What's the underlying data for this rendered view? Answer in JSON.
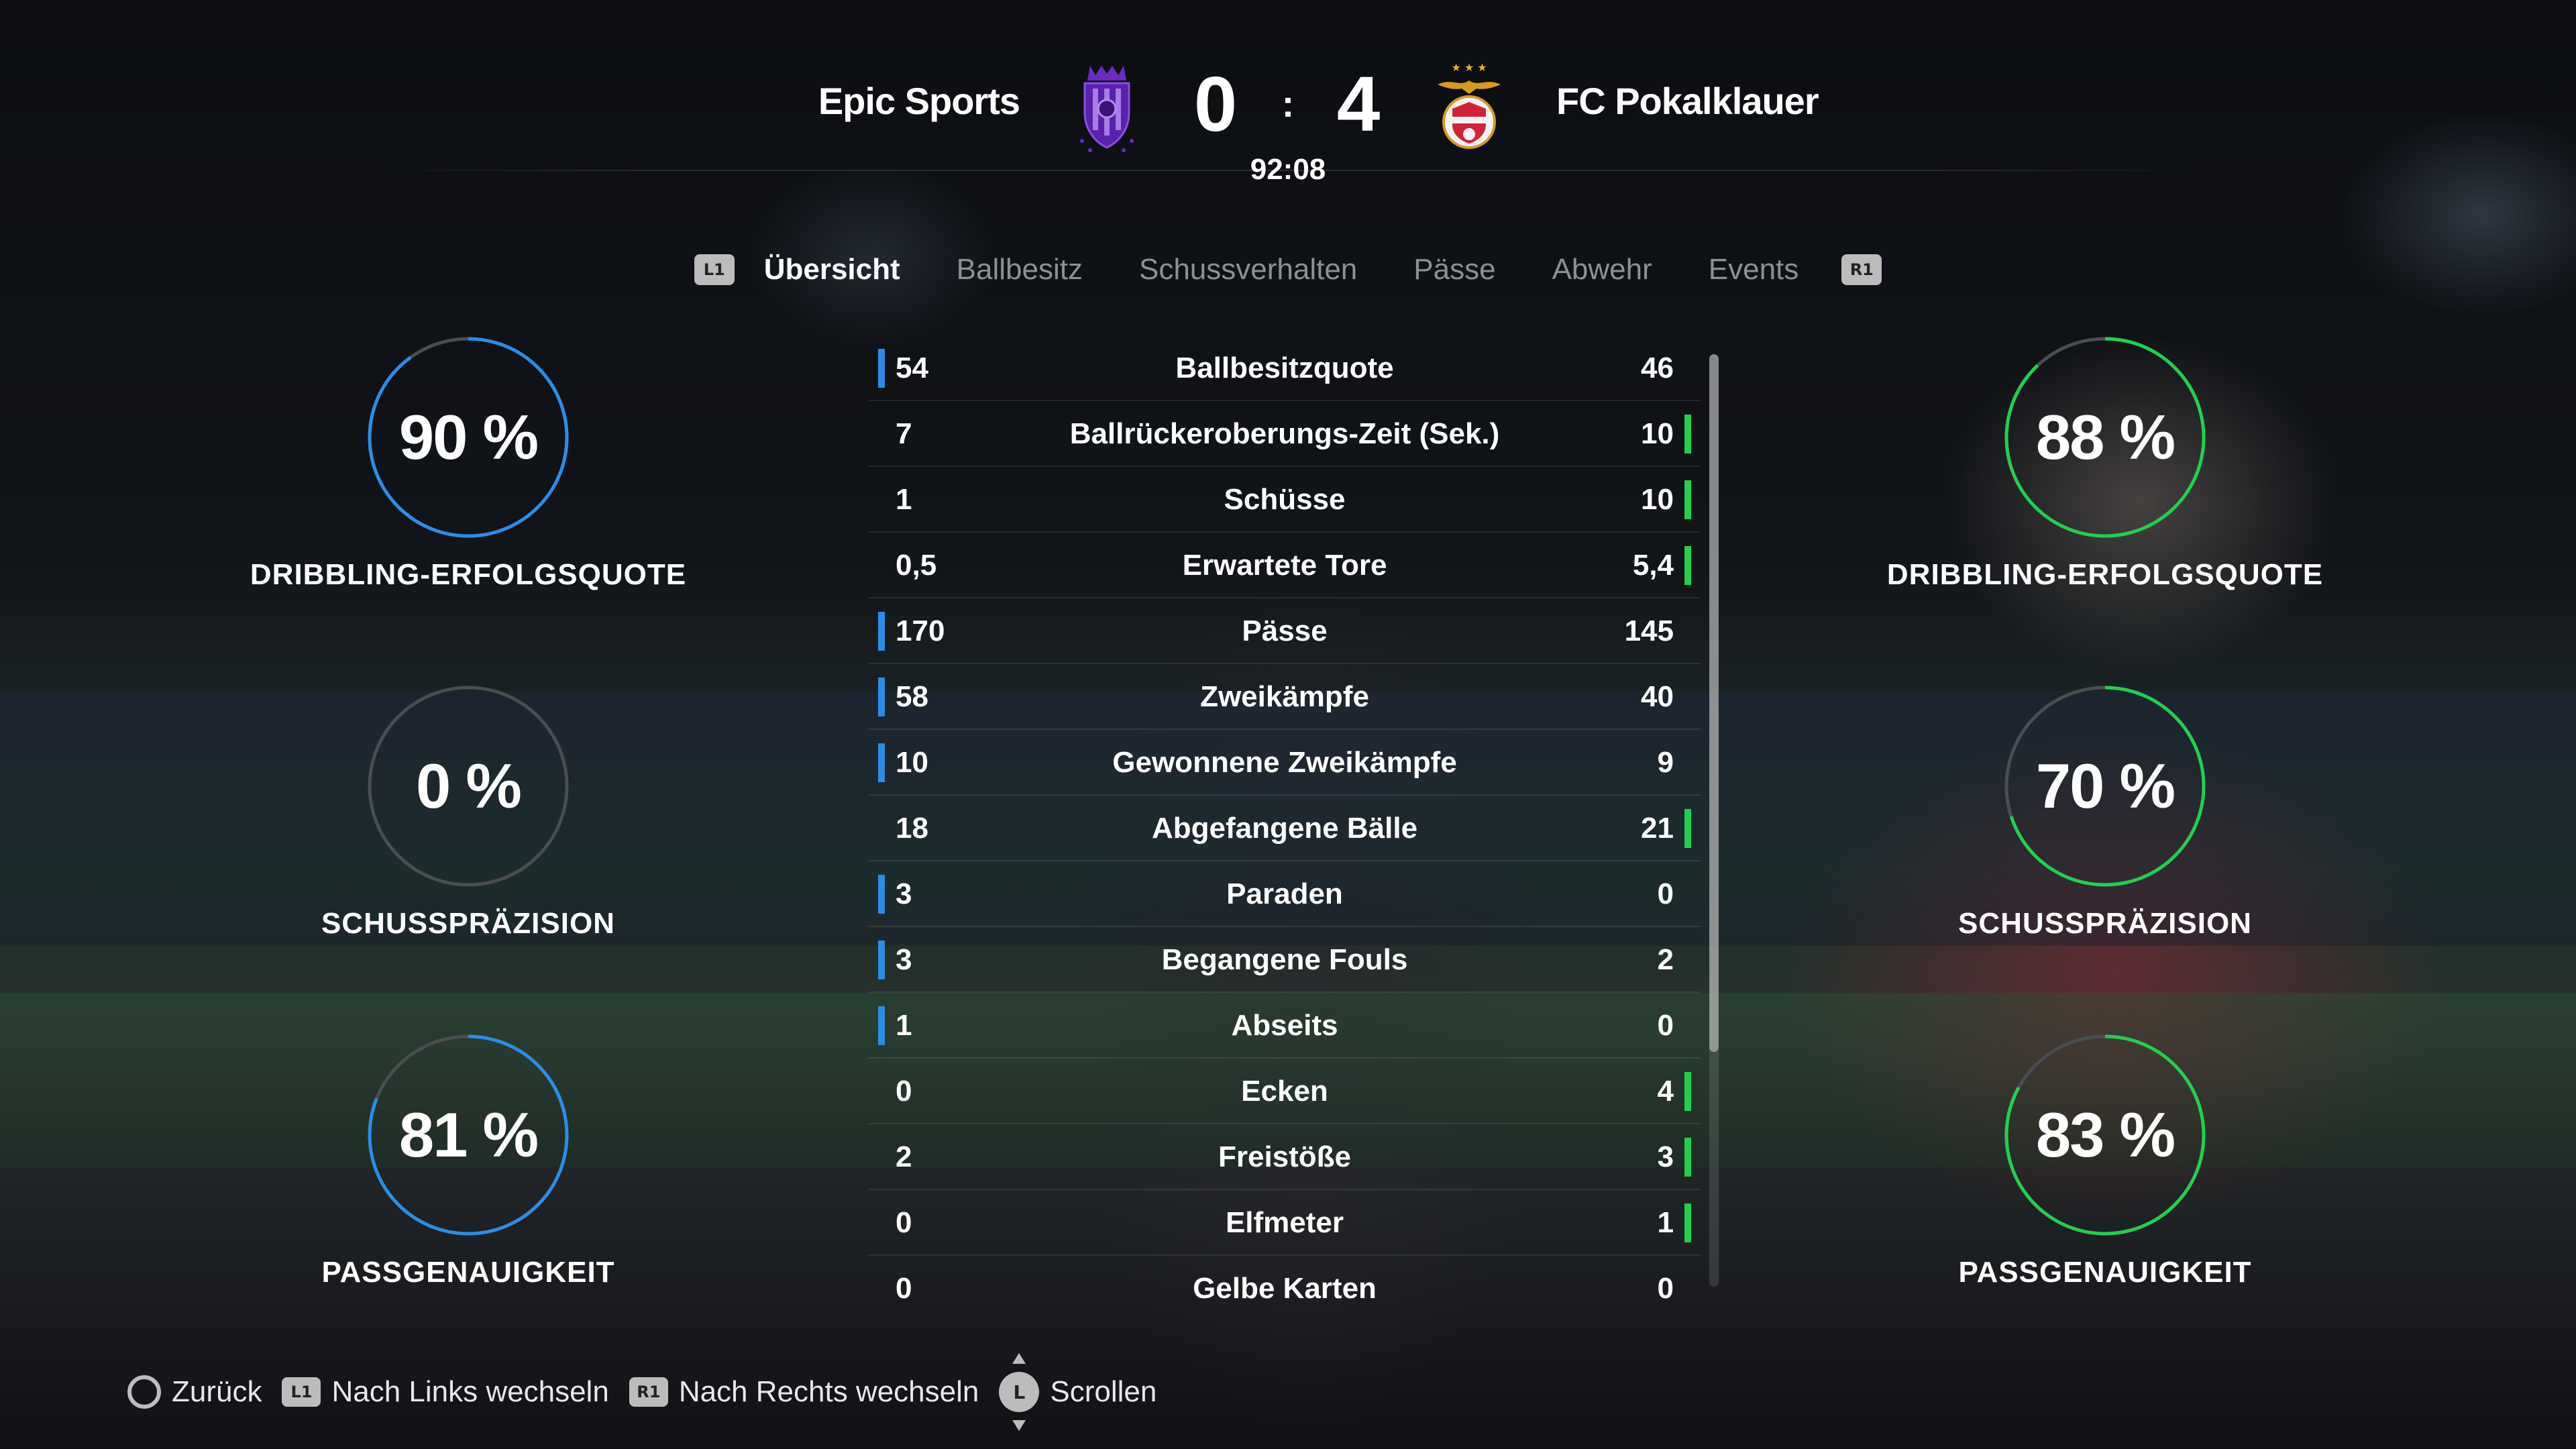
{
  "header": {
    "home_team": "Epic Sports",
    "away_team": "FC Pokalklauer",
    "home_score": "0",
    "away_score": "4",
    "score_separator": ":",
    "match_clock": "92:08"
  },
  "tabs": {
    "prev_button": "L1",
    "next_button": "R1",
    "items": [
      "Übersicht",
      "Ballbesitz",
      "Schussverhalten",
      "Pässe",
      "Abwehr",
      "Events"
    ],
    "active_index": 0
  },
  "colors": {
    "home_accent": "#2a8ee8",
    "away_accent": "#21d04e",
    "gauge_track": "#4a4d52"
  },
  "gauges": {
    "home": [
      {
        "value": "90 %",
        "fraction": 0.9,
        "label": "DRIBBLING-ERFOLGSQUOTE"
      },
      {
        "value": "0 %",
        "fraction": 0.0,
        "label": "SCHUSSPRÄZISION"
      },
      {
        "value": "81 %",
        "fraction": 0.81,
        "label": "PASSGENAUIGKEIT"
      }
    ],
    "away": [
      {
        "value": "88 %",
        "fraction": 0.88,
        "label": "DRIBBLING-ERFOLGSQUOTE"
      },
      {
        "value": "70 %",
        "fraction": 0.7,
        "label": "SCHUSSPRÄZISION"
      },
      {
        "value": "83 %",
        "fraction": 0.83,
        "label": "PASSGENAUIGKEIT"
      }
    ]
  },
  "stats": [
    {
      "name": "Ballbesitzquote",
      "home": "54",
      "away": "46",
      "leader": "home"
    },
    {
      "name": "Ballrückeroberungs-Zeit (Sek.)",
      "home": "7",
      "away": "10",
      "leader": "away"
    },
    {
      "name": "Schüsse",
      "home": "1",
      "away": "10",
      "leader": "away"
    },
    {
      "name": "Erwartete Tore",
      "home": "0,5",
      "away": "5,4",
      "leader": "away"
    },
    {
      "name": "Pässe",
      "home": "170",
      "away": "145",
      "leader": "home"
    },
    {
      "name": "Zweikämpfe",
      "home": "58",
      "away": "40",
      "leader": "home"
    },
    {
      "name": "Gewonnene Zweikämpfe",
      "home": "10",
      "away": "9",
      "leader": "home"
    },
    {
      "name": "Abgefangene Bälle",
      "home": "18",
      "away": "21",
      "leader": "away"
    },
    {
      "name": "Paraden",
      "home": "3",
      "away": "0",
      "leader": "home"
    },
    {
      "name": "Begangene Fouls",
      "home": "3",
      "away": "2",
      "leader": "home"
    },
    {
      "name": "Abseits",
      "home": "1",
      "away": "0",
      "leader": "home"
    },
    {
      "name": "Ecken",
      "home": "0",
      "away": "4",
      "leader": "away"
    },
    {
      "name": "Freistöße",
      "home": "2",
      "away": "3",
      "leader": "away"
    },
    {
      "name": "Elfmeter",
      "home": "0",
      "away": "1",
      "leader": "away"
    },
    {
      "name": "Gelbe Karten",
      "home": "0",
      "away": "0",
      "leader": "none"
    }
  ],
  "footer": {
    "back_label": "Zurück",
    "left_button": "L1",
    "left_label": "Nach Links wechseln",
    "right_button": "R1",
    "right_label": "Nach Rechts wechseln",
    "stick_button": "L",
    "scroll_label": "Scrollen"
  }
}
